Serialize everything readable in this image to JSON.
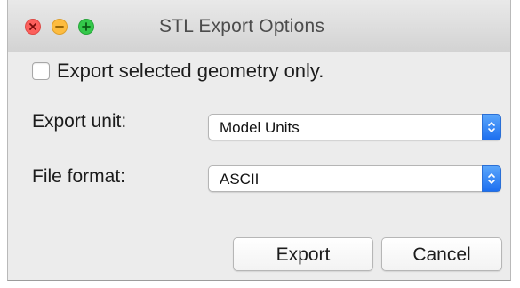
{
  "window": {
    "title": "STL Export Options"
  },
  "options": {
    "selected_only_label": "Export selected geometry only.",
    "selected_only_checked": false
  },
  "fields": {
    "unit_label": "Export unit:",
    "unit_value": "Model Units",
    "format_label": "File format:",
    "format_value": "ASCII"
  },
  "buttons": {
    "export_label": "Export",
    "cancel_label": "Cancel"
  },
  "colors": {
    "close": "#fc605c",
    "minimize": "#fdbc40",
    "maximize": "#34c84a",
    "select_accent": "#1d6ff0"
  }
}
